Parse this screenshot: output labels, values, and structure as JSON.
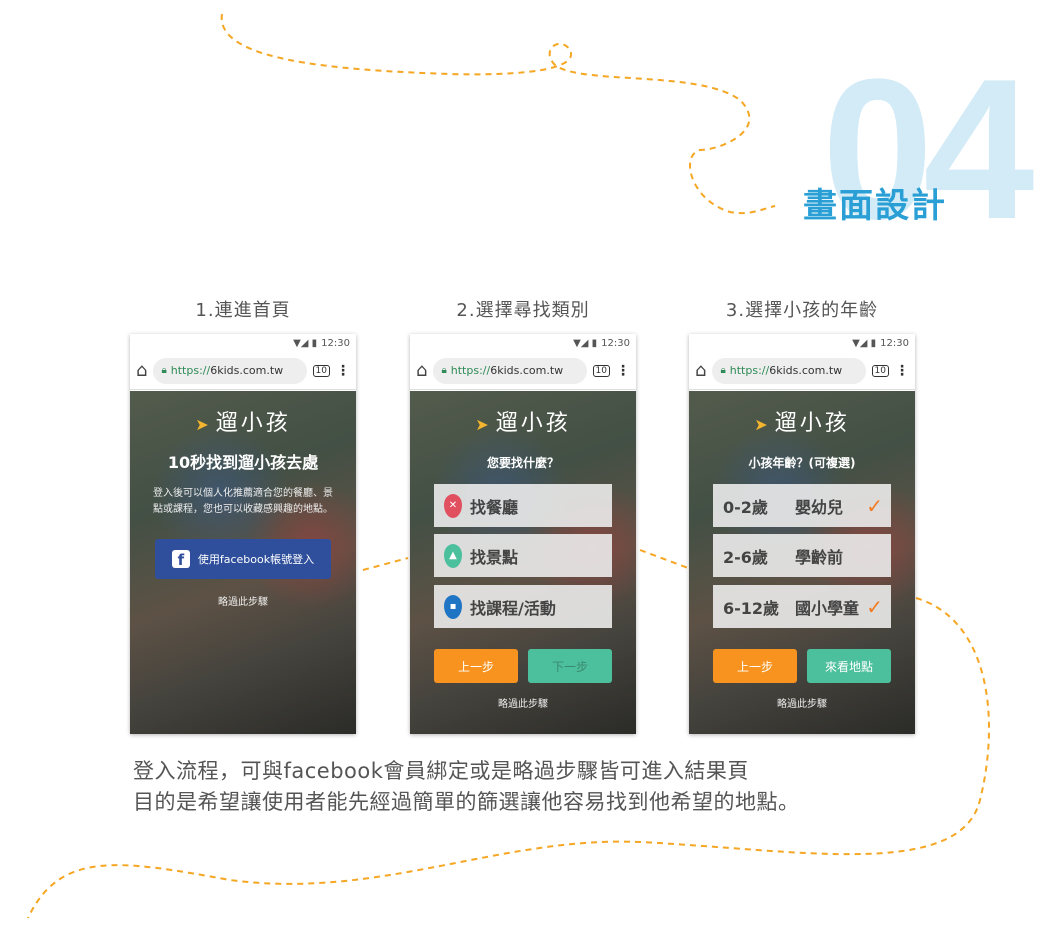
{
  "header": {
    "number": "04",
    "section_title": "畫面設計"
  },
  "captions": [
    "1.連進首頁",
    "2.選擇尋找類別",
    "3.選擇小孩的年齡"
  ],
  "browser": {
    "time": "12:30",
    "url_scheme": "https://",
    "url_host": "6kids.com.tw",
    "tab_count": "10"
  },
  "app": {
    "logo": "遛小孩",
    "skip": "略過此步驟"
  },
  "screen1": {
    "title": "10秒找到遛小孩去處",
    "description": "登入後可以個人化推薦適合您的餐廳、景點或課程，您也可以收藏感興趣的地點。",
    "fb_button": "使用facebook帳號登入"
  },
  "screen2": {
    "question": "您要找什麼？",
    "options": [
      {
        "label": "找餐廳",
        "icon": "restaurant-pin-icon",
        "color": "#e0505f"
      },
      {
        "label": "找景點",
        "icon": "scenery-pin-icon",
        "color": "#4cbf9c"
      },
      {
        "label": "找課程/活動",
        "icon": "course-pin-icon",
        "color": "#1f74c4"
      }
    ],
    "prev": "上一步",
    "next": "下一步"
  },
  "screen3": {
    "question": "小孩年齡？(可複選)",
    "options": [
      {
        "age": "0-2歲",
        "label": "嬰幼兒",
        "checked": true
      },
      {
        "age": "2-6歲",
        "label": "學齡前",
        "checked": false
      },
      {
        "age": "6-12歲",
        "label": "國小學童",
        "checked": true
      }
    ],
    "prev": "上一步",
    "next": "來看地點"
  },
  "footer": {
    "line1": "登入流程，可與facebook會員綁定或是略過步驟皆可進入結果頁",
    "line2": "目的是希望讓使用者能先經過簡單的篩選讓他容易找到他希望的地點。"
  },
  "colors": {
    "accent_blue": "#2a9fd6",
    "orange": "#f7931e",
    "green": "#4cbf9c",
    "fb": "#2f4f9c"
  }
}
